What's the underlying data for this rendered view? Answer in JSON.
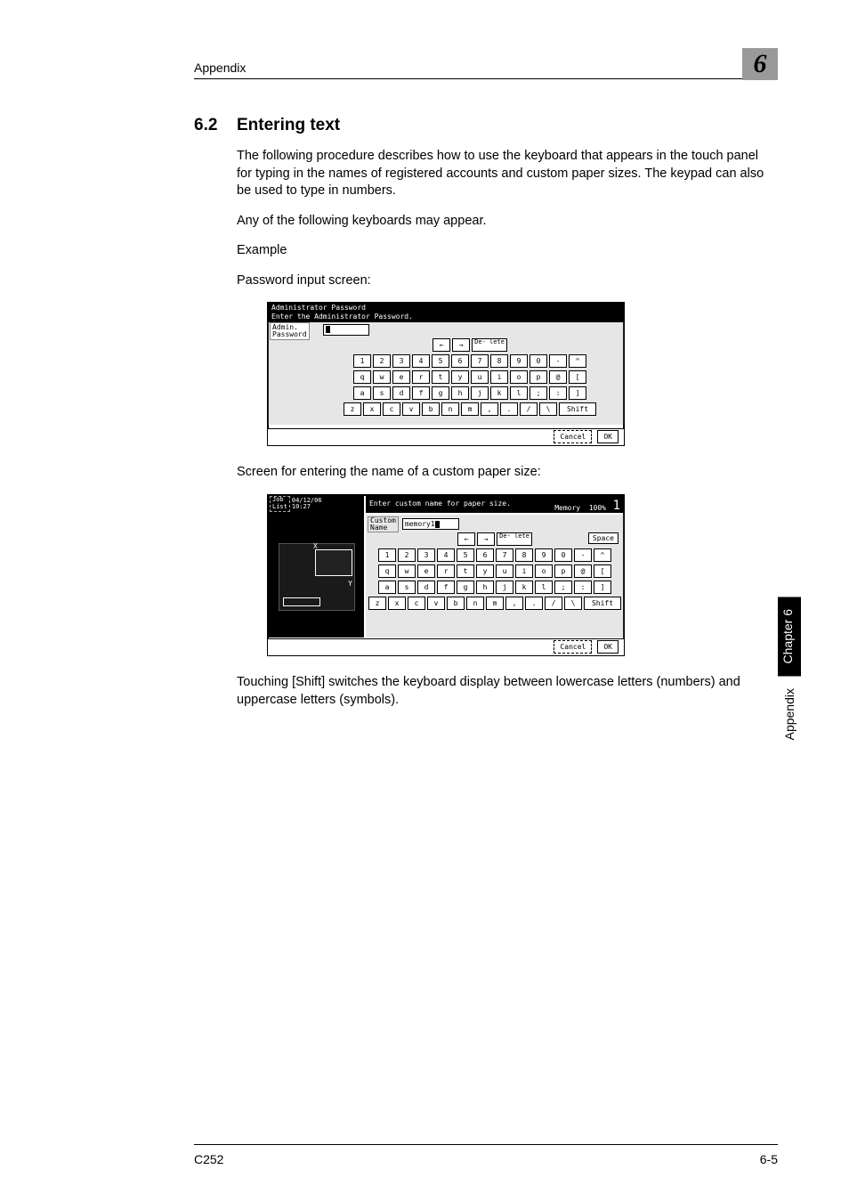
{
  "header": {
    "appendix": "Appendix",
    "chapterNum": "6"
  },
  "section": {
    "num": "6.2",
    "title": "Entering text"
  },
  "paragraphs": {
    "p1": "The following procedure describes how to use the keyboard that appears in the touch panel for typing in the names of registered accounts and custom paper sizes. The keypad can also be used to type in numbers.",
    "p2": "Any of the following keyboards may appear.",
    "p3": "Example",
    "p4": "Password input screen:",
    "p5": "Screen for entering the name of a custom paper size:",
    "p6": "Touching [Shift] switches the keyboard display between lowercase letters (numbers) and uppercase letters (symbols)."
  },
  "fig1": {
    "title1": "Administrator Password",
    "title2": "Enter the Administrator Password.",
    "label": "Admin.\nPassword",
    "navLeft": "←",
    "navRight": "→",
    "delete": "De-\nlete",
    "row1": [
      "1",
      "2",
      "3",
      "4",
      "5",
      "6",
      "7",
      "8",
      "9",
      "0",
      "-",
      "^"
    ],
    "row2": [
      "q",
      "w",
      "e",
      "r",
      "t",
      "y",
      "u",
      "i",
      "o",
      "p",
      "@",
      "["
    ],
    "row3": [
      "a",
      "s",
      "d",
      "f",
      "g",
      "h",
      "j",
      "k",
      "l",
      ";",
      ":",
      "]"
    ],
    "row4": [
      "z",
      "x",
      "c",
      "v",
      "b",
      "n",
      "m",
      ",",
      ".",
      "/",
      "\\"
    ],
    "shift": "Shift",
    "cancel": "Cancel",
    "ok": "OK"
  },
  "fig2": {
    "jobList": "Job\nList",
    "datetime": "04/12/06\n10:27",
    "titleRight": "Enter custom name for paper size.",
    "memory": "Memory",
    "memoryPct": "100%",
    "idx": "1",
    "xLabel": "X",
    "yLabel": "Y",
    "customNameLabel": "Custom\nName",
    "customNameValue": "memory1",
    "navLeft": "←",
    "navRight": "→",
    "delete": "De-\nlete",
    "space": "Space",
    "row1": [
      "1",
      "2",
      "3",
      "4",
      "5",
      "6",
      "7",
      "8",
      "9",
      "0",
      "-",
      "^"
    ],
    "row2": [
      "q",
      "w",
      "e",
      "r",
      "t",
      "y",
      "u",
      "i",
      "o",
      "p",
      "@",
      "["
    ],
    "row3": [
      "a",
      "s",
      "d",
      "f",
      "g",
      "h",
      "j",
      "k",
      "l",
      ";",
      ":",
      "]"
    ],
    "row4": [
      "z",
      "x",
      "c",
      "v",
      "b",
      "n",
      "m",
      ",",
      ".",
      "/",
      "\\"
    ],
    "shift": "Shift",
    "cancel": "Cancel",
    "ok": "OK"
  },
  "sideTab": {
    "chapter": "Chapter 6",
    "appendix": "Appendix"
  },
  "footer": {
    "left": "C252",
    "right": "6-5"
  }
}
